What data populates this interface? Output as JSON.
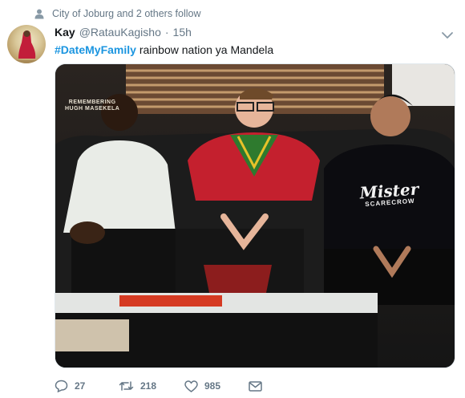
{
  "social_context": {
    "text": "City of Joburg and 2 others follow",
    "icon": "person-icon"
  },
  "tweet": {
    "author_name": "Kay",
    "handle": "@RatauKagisho",
    "separator": "·",
    "time": "15h",
    "hashtag": "#DateMyFamily",
    "text": " rainbow nation ya Mandela"
  },
  "media": {
    "watermark_line1": "REMEMBERING",
    "watermark_line2": "HUGH MASEKELA",
    "shirt_text_main": "Mister",
    "shirt_text_sub": "SCARECROW"
  },
  "actions": {
    "replies": "27",
    "retweets": "218",
    "likes": "985"
  },
  "colors": {
    "link": "#1b95e0",
    "muted": "#657786",
    "text": "#14171a"
  }
}
